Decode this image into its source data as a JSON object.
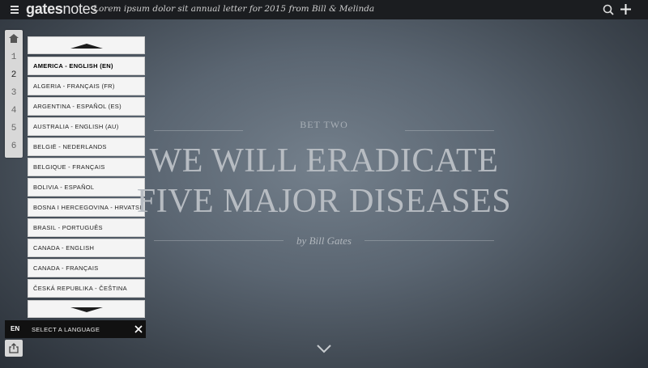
{
  "header": {
    "logo_bold": "gates",
    "logo_light": "notes",
    "tagline": "Lorem ipsum dolor sit annual letter for 2015 from Bill & Melinda"
  },
  "rail": {
    "pages": [
      "1",
      "2",
      "3",
      "4",
      "5",
      "6"
    ],
    "active_page": "2"
  },
  "languages": {
    "items": [
      "AMERICA - ENGLISH (EN)",
      "ALGERIA - FRANÇAIS (FR)",
      "ARGENTINA - ESPAÑOL (ES)",
      "AUSTRALIA - ENGLISH (AU)",
      "BELGIË - NEDERLANDS",
      "BELGIQUE - FRANÇAIS",
      "BOLIVIA - ESPAÑOL",
      "BOSNA I HERCEGOVINA - HRVATSKI",
      "BRASIL - PORTUGUÊS",
      "CANADA - ENGLISH",
      "CANADA - FRANÇAIS",
      "ČESKÁ REPUBLIKA - ČEŠTINA"
    ],
    "selected_index": 0,
    "current_code": "EN",
    "select_label": "SELECT A LANGUAGE"
  },
  "hero": {
    "eyebrow": "BET TWO",
    "headline_line1": "WE WILL ERADICATE",
    "headline_line2": "FIVE MAJOR DISEASES",
    "byline": "by Bill Gates"
  }
}
